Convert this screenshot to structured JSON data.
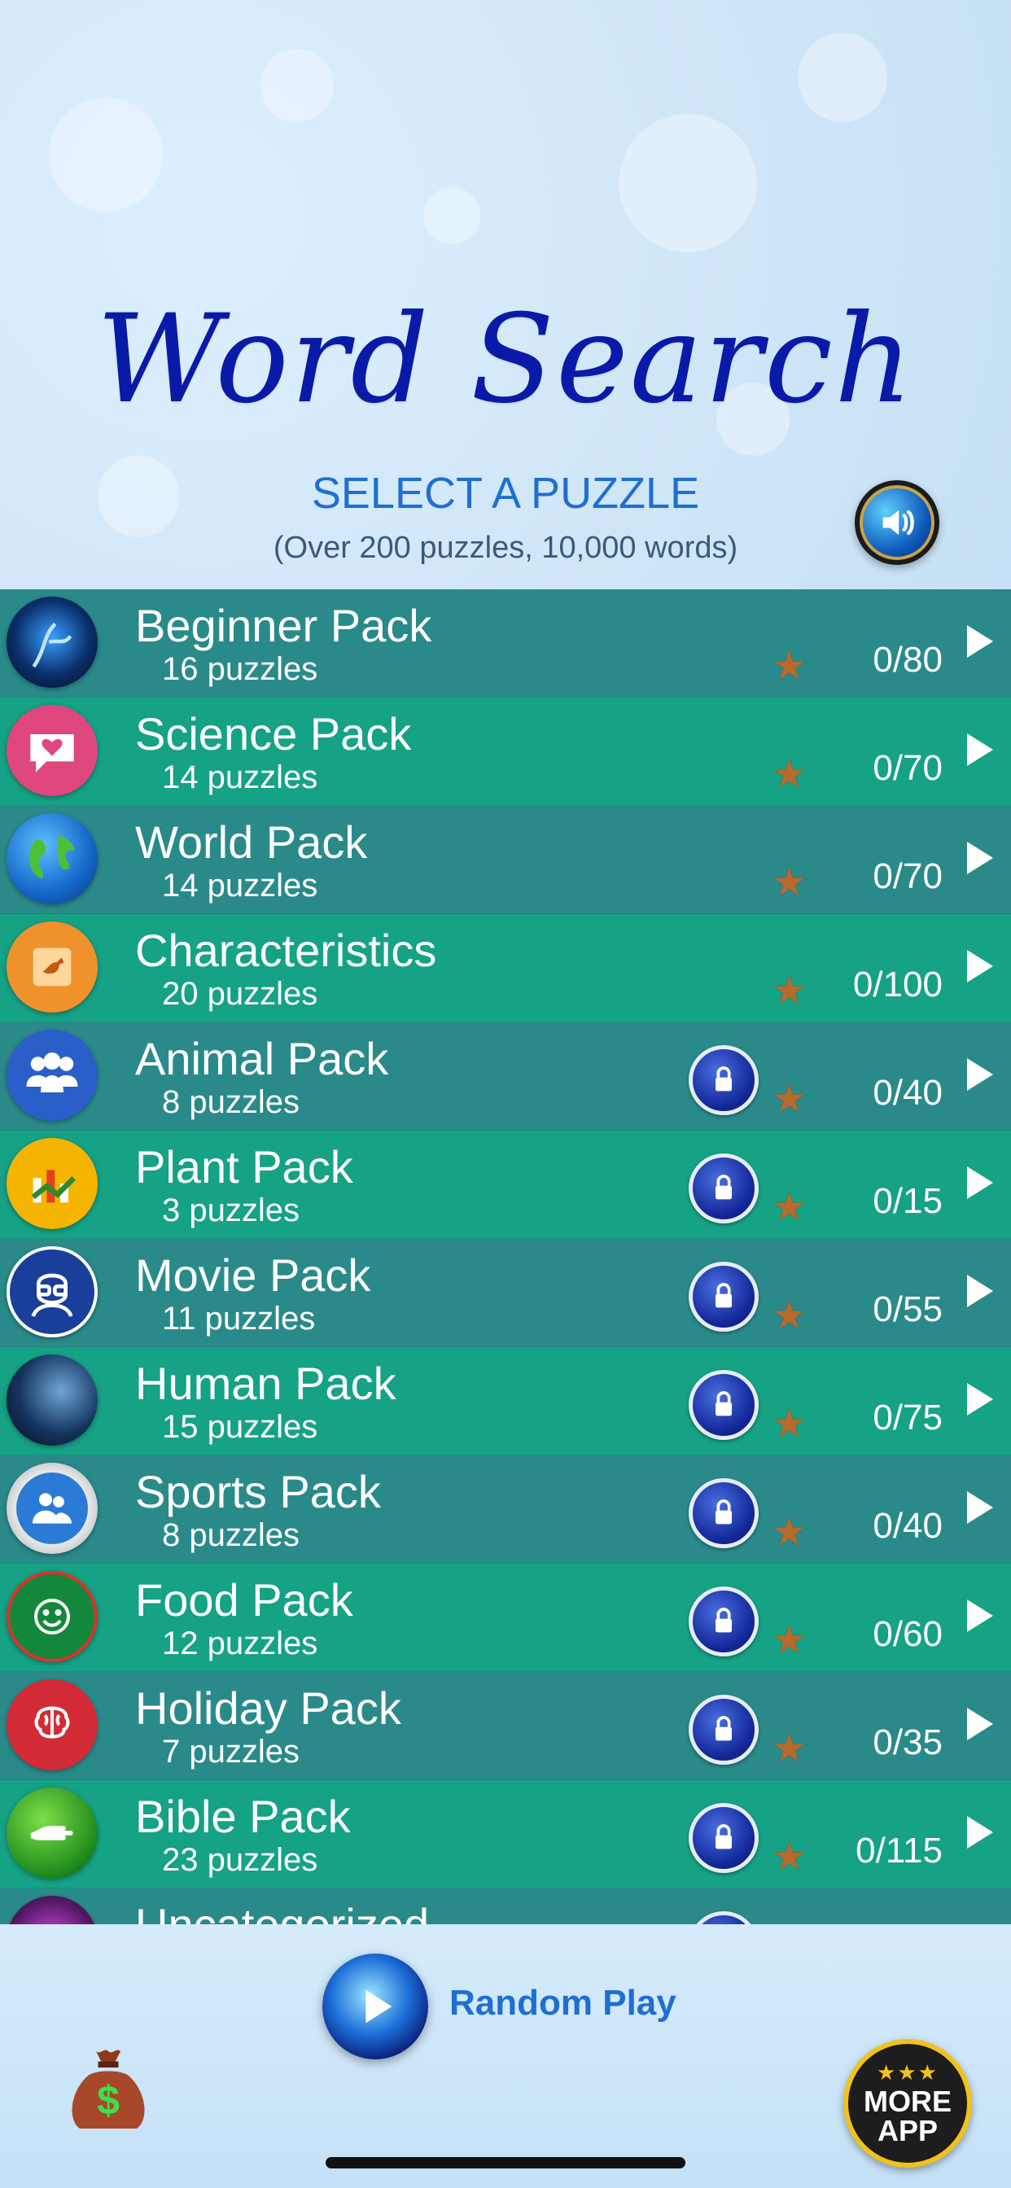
{
  "header": {
    "title": "Word Search",
    "subtitle": "SELECT A PUZZLE",
    "note": "(Over 200 puzzles, 10,000 words)",
    "sound_icon": "speaker-icon"
  },
  "packs": [
    {
      "name": "Beginner Pack",
      "count": "16 puzzles",
      "score": "0/80",
      "locked": false,
      "icon": "lightning-icon"
    },
    {
      "name": "Science Pack",
      "count": "14 puzzles",
      "score": "0/70",
      "locked": false,
      "icon": "heart-bubble-icon"
    },
    {
      "name": "World Pack",
      "count": "14 puzzles",
      "score": "0/70",
      "locked": false,
      "icon": "globe-icon"
    },
    {
      "name": "Characteristics",
      "count": "20 puzzles",
      "score": "0/100",
      "locked": false,
      "icon": "bird-note-icon"
    },
    {
      "name": "Animal Pack",
      "count": "8 puzzles",
      "score": "0/40",
      "locked": true,
      "icon": "people-group-icon"
    },
    {
      "name": "Plant Pack",
      "count": "3 puzzles",
      "score": "0/15",
      "locked": true,
      "icon": "chart-icon"
    },
    {
      "name": "Movie Pack",
      "count": "11 puzzles",
      "score": "0/55",
      "locked": true,
      "icon": "glasses-face-icon"
    },
    {
      "name": "Human Pack",
      "count": "15 puzzles",
      "score": "0/75",
      "locked": true,
      "icon": "planet-icon"
    },
    {
      "name": "Sports Pack",
      "count": "8 puzzles",
      "score": "0/40",
      "locked": true,
      "icon": "users-icon"
    },
    {
      "name": "Food Pack",
      "count": "12 puzzles",
      "score": "0/60",
      "locked": true,
      "icon": "smiley-icon"
    },
    {
      "name": "Holiday Pack",
      "count": "7 puzzles",
      "score": "0/35",
      "locked": true,
      "icon": "brain-icon"
    },
    {
      "name": "Bible Pack",
      "count": "23 puzzles",
      "score": "0/115",
      "locked": true,
      "icon": "hand-icon"
    },
    {
      "name": "Uncategorized",
      "count": "",
      "score": "",
      "locked": true,
      "icon": "camera-icon"
    }
  ],
  "bottom": {
    "random_label": "Random Play",
    "more_app_line1": "MORE",
    "more_app_line2": "APP",
    "money_icon": "money-bag-icon"
  },
  "colors": {
    "row_dark": "#2a8a8a",
    "row_light": "#15a285",
    "title": "#0a1aa8",
    "accent": "#1f6fd3",
    "star": "#b86a2e"
  }
}
